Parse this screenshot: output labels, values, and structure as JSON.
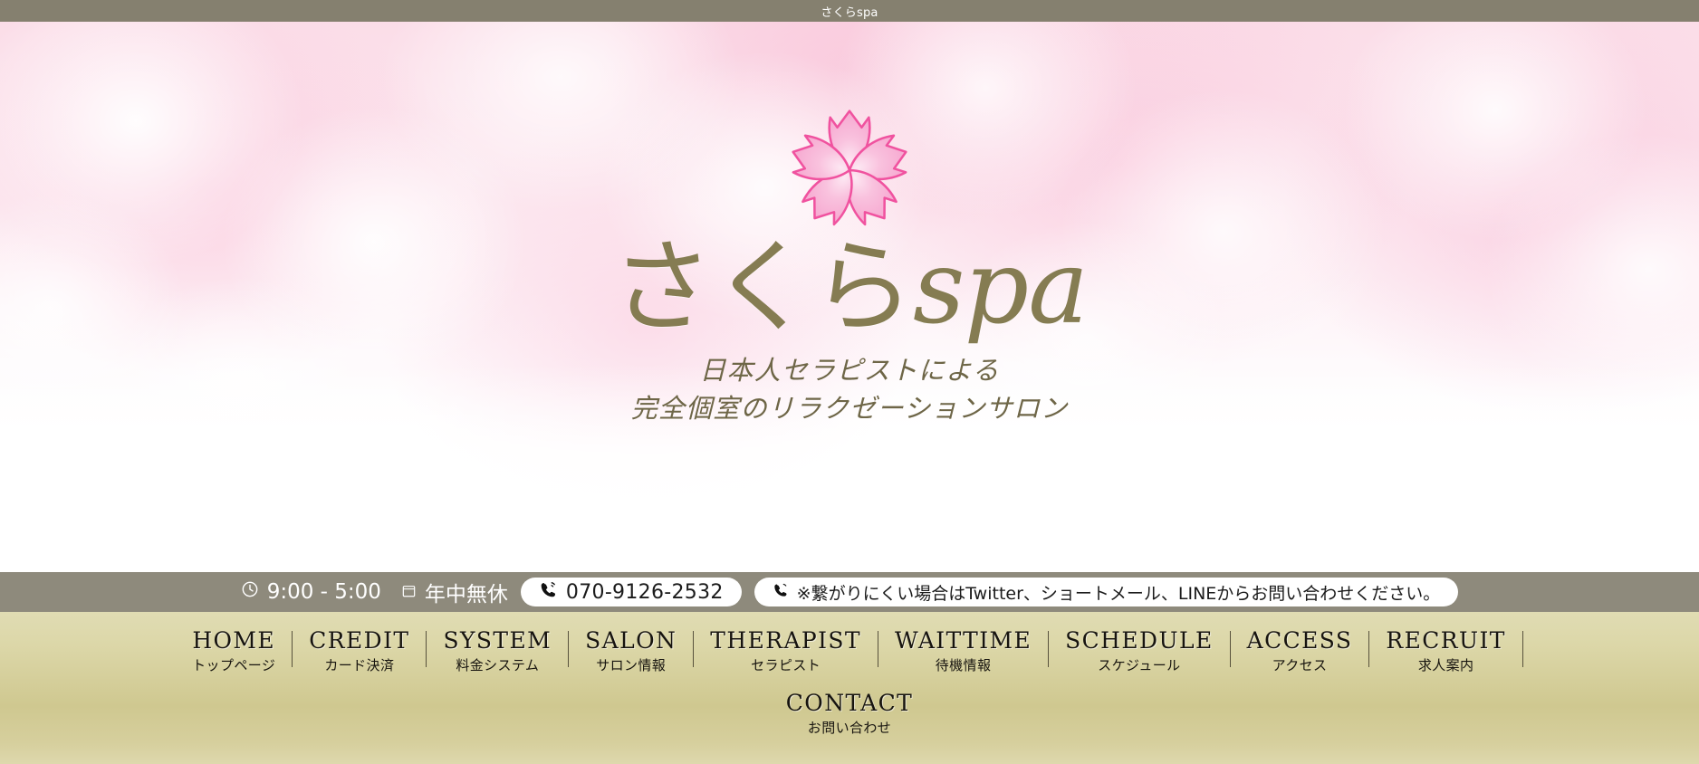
{
  "window": {
    "title": "さくらspa"
  },
  "hero": {
    "logo_icon": "sakura-blossom-icon",
    "brand_jp": "さくら",
    "brand_latin": "spa",
    "tagline_line1": "日本人セラピストによる",
    "tagline_line2": "完全個室のリラクゼーションサロン"
  },
  "infobar": {
    "clock_icon": "clock-icon",
    "hours": "9:00 - 5:00",
    "calendar_icon": "calendar-icon",
    "open_days": "年中無休",
    "phone_icon": "phone-icon",
    "phone": "070-9126-2532",
    "note_icon": "phone-icon",
    "note": "※繋がりにくい場合はTwitter、ショートメール、LINEからお問い合わせください。"
  },
  "nav": {
    "items": [
      {
        "en": "HOME",
        "jp": "トップページ"
      },
      {
        "en": "CREDIT",
        "jp": "カード決済"
      },
      {
        "en": "SYSTEM",
        "jp": "料金システム"
      },
      {
        "en": "SALON",
        "jp": "サロン情報"
      },
      {
        "en": "THERAPIST",
        "jp": "セラピスト"
      },
      {
        "en": "WAITTIME",
        "jp": "待機情報"
      },
      {
        "en": "SCHEDULE",
        "jp": "スケジュール"
      },
      {
        "en": "ACCESS",
        "jp": "アクセス"
      },
      {
        "en": "RECRUIT",
        "jp": "求人案内"
      }
    ],
    "contact": {
      "en": "CONTACT",
      "jp": "お問い合わせ"
    }
  },
  "colors": {
    "titlebar_bg": "#85806f",
    "infobar_bg": "#8e8a7c",
    "nav_bg": "#d6cf9d",
    "brand_gold": "#857c52",
    "sakura_pink": "#f7b3d4",
    "sakura_outline": "#f06bb0"
  }
}
